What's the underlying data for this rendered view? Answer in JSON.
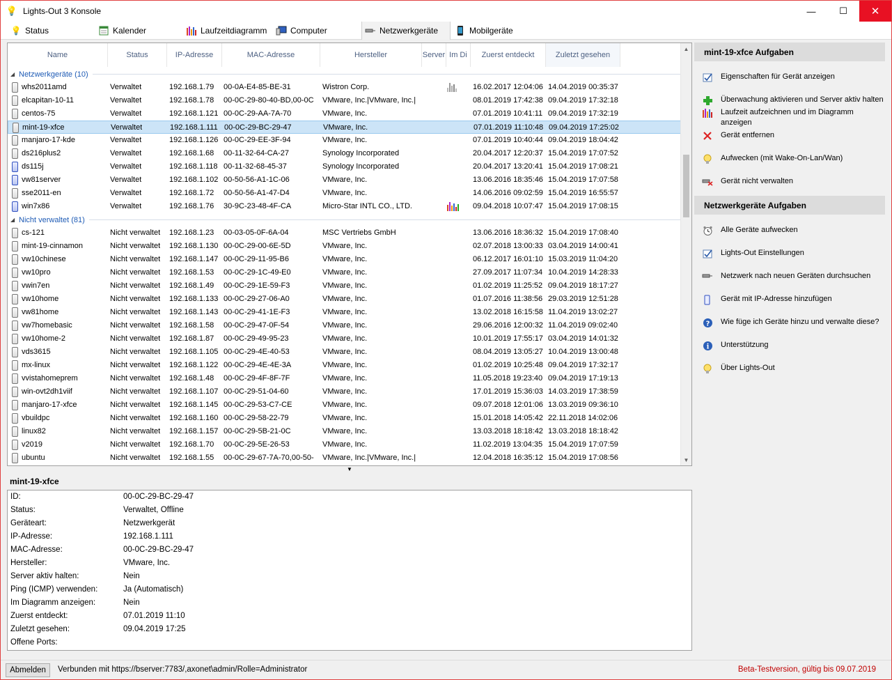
{
  "window": {
    "title": "Lights-Out 3 Konsole",
    "minimize": "—",
    "maximize": "☐",
    "close": "✕"
  },
  "tabs": [
    {
      "label": "Status",
      "icon": "bulb-icon"
    },
    {
      "label": "Kalender",
      "icon": "calendar-icon"
    },
    {
      "label": "Laufzeitdiagramm",
      "icon": "bar-chart-icon"
    },
    {
      "label": "Computer",
      "icon": "computer-icon"
    },
    {
      "label": "Netzwerkgeräte",
      "icon": "network-device-icon"
    },
    {
      "label": "Mobilgeräte",
      "icon": "mobile-icon"
    }
  ],
  "columns": [
    "Name",
    "Status",
    "IP-Adresse",
    "MAC-Adresse",
    "Hersteller",
    "Server",
    "Im Di",
    "Zuerst entdeckt",
    "Zuletzt gesehen"
  ],
  "groups": [
    {
      "label": "Netzwerkgeräte (10)",
      "rows": [
        {
          "name": "whs2011amd",
          "status": "Verwaltet",
          "ip": "192.168.1.79",
          "mac": "00-0A-E4-85-BE-31",
          "vendor": "Wistron Corp.",
          "chart": "grey",
          "first": "16.02.2017 12:04:06",
          "last": "14.04.2019 00:35:37",
          "icon": "device"
        },
        {
          "name": "elcapitan-10-11",
          "status": "Verwaltet",
          "ip": "192.168.1.78",
          "mac": "00-0C-29-80-40-BD,00-0C",
          "vendor": "VMware, Inc.|VMware, Inc.|",
          "chart": "",
          "first": "08.01.2019 17:42:38",
          "last": "09.04.2019 17:32:18",
          "icon": "device"
        },
        {
          "name": "centos-75",
          "status": "Verwaltet",
          "ip": "192.168.1.121",
          "mac": "00-0C-29-AA-7A-70",
          "vendor": "VMware, Inc.",
          "chart": "",
          "first": "07.01.2019 10:41:11",
          "last": "09.04.2019 17:32:19",
          "icon": "device"
        },
        {
          "name": "mint-19-xfce",
          "status": "Verwaltet",
          "ip": "192.168.1.111",
          "mac": "00-0C-29-BC-29-47",
          "vendor": "VMware, Inc.",
          "chart": "",
          "first": "07.01.2019 11:10:48",
          "last": "09.04.2019 17:25:02",
          "icon": "device",
          "selected": true
        },
        {
          "name": "manjaro-17-kde",
          "status": "Verwaltet",
          "ip": "192.168.1.126",
          "mac": "00-0C-29-EE-3F-94",
          "vendor": "VMware, Inc.",
          "chart": "",
          "first": "07.01.2019 10:40:44",
          "last": "09.04.2019 18:04:42",
          "icon": "device"
        },
        {
          "name": "ds216plus2",
          "status": "Verwaltet",
          "ip": "192.168.1.68",
          "mac": "00-11-32-64-CA-27",
          "vendor": "Synology Incorporated",
          "chart": "",
          "first": "20.04.2017 12:20:37",
          "last": "15.04.2019 17:07:52",
          "icon": "device"
        },
        {
          "name": "ds115j",
          "status": "Verwaltet",
          "ip": "192.168.1.118",
          "mac": "00-11-32-68-45-37",
          "vendor": "Synology Incorporated",
          "chart": "",
          "first": "20.04.2017 13:20:41",
          "last": "15.04.2019 17:08:21",
          "icon": "win"
        },
        {
          "name": "vw81server",
          "status": "Verwaltet",
          "ip": "192.168.1.102",
          "mac": "00-50-56-A1-1C-06",
          "vendor": "VMware, Inc.",
          "chart": "",
          "first": "13.06.2016 18:35:46",
          "last": "15.04.2019 17:07:58",
          "icon": "win"
        },
        {
          "name": "sse2011-en",
          "status": "Verwaltet",
          "ip": "192.168.1.72",
          "mac": "00-50-56-A1-47-D4",
          "vendor": "VMware, Inc.",
          "chart": "",
          "first": "14.06.2016 09:02:59",
          "last": "15.04.2019 16:55:57",
          "icon": "device"
        },
        {
          "name": "win7x86",
          "status": "Verwaltet",
          "ip": "192.168.1.76",
          "mac": "30-9C-23-48-4F-CA",
          "vendor": "Micro-Star INTL CO., LTD.",
          "chart": "color",
          "first": "09.04.2018 10:07:47",
          "last": "15.04.2019 17:08:15",
          "icon": "win"
        }
      ]
    },
    {
      "label": "Nicht verwaltet (81)",
      "rows": [
        {
          "name": "cs-121",
          "status": "Nicht verwaltet",
          "ip": "192.168.1.23",
          "mac": "00-03-05-0F-6A-04",
          "vendor": "MSC Vertriebs GmbH",
          "chart": "",
          "first": "13.06.2016 18:36:32",
          "last": "15.04.2019 17:08:40",
          "icon": "device"
        },
        {
          "name": "mint-19-cinnamon",
          "status": "Nicht verwaltet",
          "ip": "192.168.1.130",
          "mac": "00-0C-29-00-6E-5D",
          "vendor": "VMware, Inc.",
          "chart": "",
          "first": "02.07.2018 13:00:33",
          "last": "03.04.2019 14:00:41",
          "icon": "device"
        },
        {
          "name": "vw10chinese",
          "status": "Nicht verwaltet",
          "ip": "192.168.1.147",
          "mac": "00-0C-29-11-95-B6",
          "vendor": "VMware, Inc.",
          "chart": "",
          "first": "06.12.2017 16:01:10",
          "last": "15.03.2019 11:04:20",
          "icon": "device"
        },
        {
          "name": "vw10pro",
          "status": "Nicht verwaltet",
          "ip": "192.168.1.53",
          "mac": "00-0C-29-1C-49-E0",
          "vendor": "VMware, Inc.",
          "chart": "",
          "first": "27.09.2017 11:07:34",
          "last": "10.04.2019 14:28:33",
          "icon": "device"
        },
        {
          "name": "vwin7en",
          "status": "Nicht verwaltet",
          "ip": "192.168.1.49",
          "mac": "00-0C-29-1E-59-F3",
          "vendor": "VMware, Inc.",
          "chart": "",
          "first": "01.02.2019 11:25:52",
          "last": "09.04.2019 18:17:27",
          "icon": "device"
        },
        {
          "name": "vw10home",
          "status": "Nicht verwaltet",
          "ip": "192.168.1.133",
          "mac": "00-0C-29-27-06-A0",
          "vendor": "VMware, Inc.",
          "chart": "",
          "first": "01.07.2016 11:38:56",
          "last": "29.03.2019 12:51:28",
          "icon": "device"
        },
        {
          "name": "vw81home",
          "status": "Nicht verwaltet",
          "ip": "192.168.1.143",
          "mac": "00-0C-29-41-1E-F3",
          "vendor": "VMware, Inc.",
          "chart": "",
          "first": "13.02.2018 16:15:58",
          "last": "11.04.2019 13:02:27",
          "icon": "device"
        },
        {
          "name": "vw7homebasic",
          "status": "Nicht verwaltet",
          "ip": "192.168.1.58",
          "mac": "00-0C-29-47-0F-54",
          "vendor": "VMware, Inc.",
          "chart": "",
          "first": "29.06.2016 12:00:32",
          "last": "11.04.2019 09:02:40",
          "icon": "device"
        },
        {
          "name": "vw10home-2",
          "status": "Nicht verwaltet",
          "ip": "192.168.1.87",
          "mac": "00-0C-29-49-95-23",
          "vendor": "VMware, Inc.",
          "chart": "",
          "first": "10.01.2019 17:55:17",
          "last": "03.04.2019 14:01:32",
          "icon": "device"
        },
        {
          "name": "vds3615",
          "status": "Nicht verwaltet",
          "ip": "192.168.1.105",
          "mac": "00-0C-29-4E-40-53",
          "vendor": "VMware, Inc.",
          "chart": "",
          "first": "08.04.2019 13:05:27",
          "last": "10.04.2019 13:00:48",
          "icon": "device"
        },
        {
          "name": "mx-linux",
          "status": "Nicht verwaltet",
          "ip": "192.168.1.122",
          "mac": "00-0C-29-4E-4E-3A",
          "vendor": "VMware, Inc.",
          "chart": "",
          "first": "01.02.2019 10:25:48",
          "last": "09.04.2019 17:32:17",
          "icon": "device"
        },
        {
          "name": "vvistahomeprem",
          "status": "Nicht verwaltet",
          "ip": "192.168.1.48",
          "mac": "00-0C-29-4F-8F-7F",
          "vendor": "VMware, Inc.",
          "chart": "",
          "first": "11.05.2018 19:23:40",
          "last": "09.04.2019 17:19:13",
          "icon": "device"
        },
        {
          "name": "win-ovt2dh1viif",
          "status": "Nicht verwaltet",
          "ip": "192.168.1.107",
          "mac": "00-0C-29-51-04-60",
          "vendor": "VMware, Inc.",
          "chart": "",
          "first": "17.01.2019 15:36:03",
          "last": "14.03.2019 17:38:59",
          "icon": "device"
        },
        {
          "name": "manjaro-17-xfce",
          "status": "Nicht verwaltet",
          "ip": "192.168.1.145",
          "mac": "00-0C-29-53-C7-CE",
          "vendor": "VMware, Inc.",
          "chart": "",
          "first": "09.07.2018 12:01:06",
          "last": "13.03.2019 09:36:10",
          "icon": "device"
        },
        {
          "name": "vbuildpc",
          "status": "Nicht verwaltet",
          "ip": "192.168.1.160",
          "mac": "00-0C-29-58-22-79",
          "vendor": "VMware, Inc.",
          "chart": "",
          "first": "15.01.2018 14:05:42",
          "last": "22.11.2018 14:02:06",
          "icon": "device"
        },
        {
          "name": "linux82",
          "status": "Nicht verwaltet",
          "ip": "192.168.1.157",
          "mac": "00-0C-29-5B-21-0C",
          "vendor": "VMware, Inc.",
          "chart": "",
          "first": "13.03.2018 18:18:42",
          "last": "13.03.2018 18:18:42",
          "icon": "device"
        },
        {
          "name": "v2019",
          "status": "Nicht verwaltet",
          "ip": "192.168.1.70",
          "mac": "00-0C-29-5E-26-53",
          "vendor": "VMware, Inc.",
          "chart": "",
          "first": "11.02.2019 13:04:35",
          "last": "15.04.2019 17:07:59",
          "icon": "device"
        },
        {
          "name": "ubuntu",
          "status": "Nicht verwaltet",
          "ip": "192.168.1.55",
          "mac": "00-0C-29-67-7A-70,00-50-",
          "vendor": "VMware, Inc.|VMware, Inc.|",
          "chart": "",
          "first": "12.04.2018 16:35:12",
          "last": "15.04.2019 17:08:56",
          "icon": "device"
        }
      ]
    }
  ],
  "detail": {
    "title": "mint-19-xfce",
    "fields": [
      {
        "key": "ID:",
        "value": "00-0C-29-BC-29-47"
      },
      {
        "key": "Status:",
        "value": "Verwaltet, Offline"
      },
      {
        "key": "Geräteart:",
        "value": "Netzwerkgerät"
      },
      {
        "key": "IP-Adresse:",
        "value": "192.168.1.111"
      },
      {
        "key": "MAC-Adresse:",
        "value": "00-0C-29-BC-29-47"
      },
      {
        "key": "Hersteller:",
        "value": "VMware, Inc."
      },
      {
        "key": "Server aktiv halten:",
        "value": "Nein"
      },
      {
        "key": "Ping (ICMP) verwenden:",
        "value": "Ja (Automatisch)"
      },
      {
        "key": "Im Diagramm anzeigen:",
        "value": "Nein"
      },
      {
        "key": "Zuerst entdeckt:",
        "value": "07.01.2019 11:10"
      },
      {
        "key": "Zuletzt gesehen:",
        "value": "09.04.2019 17:25"
      },
      {
        "key": "Offene Ports:",
        "value": ""
      }
    ]
  },
  "sidebar": {
    "device_tasks_title": "mint-19-xfce Aufgaben",
    "device_tasks": [
      {
        "label": "Eigenschaften für Gerät anzeigen",
        "icon": "checkbox-icon"
      },
      {
        "label": "Überwachung aktivieren und Server aktiv halten",
        "icon": "plus-icon"
      },
      {
        "label": "Laufzeit aufzeichnen und im Diagramm anzeigen",
        "icon": "bar-chart-icon"
      },
      {
        "label": "Gerät entfernen",
        "icon": "delete-icon"
      },
      {
        "label": "Aufwecken (mit Wake-On-Lan/Wan)",
        "icon": "bulb-icon"
      },
      {
        "label": "Gerät nicht verwalten",
        "icon": "unmanage-icon"
      }
    ],
    "network_tasks_title": "Netzwerkgeräte Aufgaben",
    "network_tasks": [
      {
        "label": "Alle Geräte aufwecken",
        "icon": "alarm-clock-icon"
      },
      {
        "label": "Lights-Out Einstellungen",
        "icon": "checkbox-icon"
      },
      {
        "label": "Netzwerk nach neuen Geräten durchsuchen",
        "icon": "network-scan-icon"
      },
      {
        "label": "Gerät mit IP-Adresse hinzufügen",
        "icon": "device-add-icon"
      },
      {
        "label": "Wie füge ich Geräte hinzu und verwalte diese?",
        "icon": "help-icon"
      },
      {
        "label": "Unterstützung",
        "icon": "info-icon"
      },
      {
        "label": "Über Lights-Out",
        "icon": "bulb-icon"
      }
    ]
  },
  "statusbar": {
    "logout": "Abmelden",
    "connection": "Verbunden  mit  https://bserver:7783/,axonet\\admin/Rolle=Administrator",
    "beta": "Beta-Testversion,  gültig bis 09.07.2019"
  },
  "colors": {
    "accent": "#1e5bb5",
    "selection": "#cce4f7",
    "beta_text": "#c00000"
  }
}
